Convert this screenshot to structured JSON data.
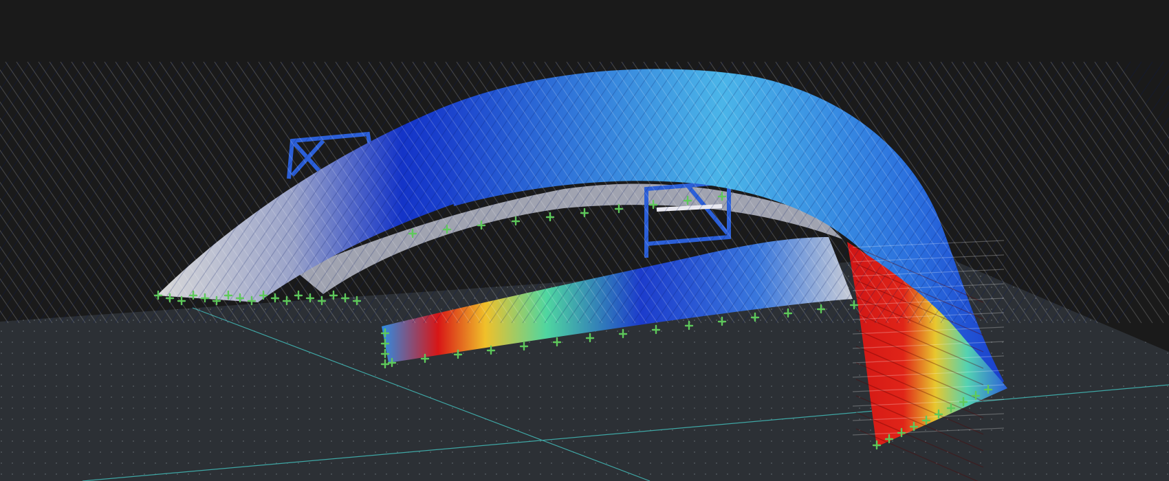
{
  "viewport": {
    "background": "#1a1a1a",
    "ground_color": "#2c3035",
    "ground_dot_color": "#5d6268",
    "axis_color": "#3fa7a5",
    "support_color": "#5ec95b"
  },
  "model": {
    "type": "space-frame-shell",
    "result_color_scale": [
      "#d0d0d0",
      "#0a1fb0",
      "#1f6fe0",
      "#4ab8e8",
      "#4fd6a0",
      "#8be04a",
      "#e8e23a",
      "#f08a1e",
      "#d81616"
    ],
    "bands": [
      {
        "id": "outer-shell",
        "label": "",
        "start_value": 0.05,
        "end_value": 0.45
      },
      {
        "id": "crown",
        "label": "",
        "start_value": 0.45,
        "end_value": 0.35
      },
      {
        "id": "inner-band",
        "label": "",
        "start_value": 0.9,
        "end_value": 0.2
      },
      {
        "id": "front-wall",
        "label": "",
        "start_value": 0.95,
        "end_value": 0.6
      }
    ]
  },
  "icons": {
    "support": "support-icon"
  }
}
